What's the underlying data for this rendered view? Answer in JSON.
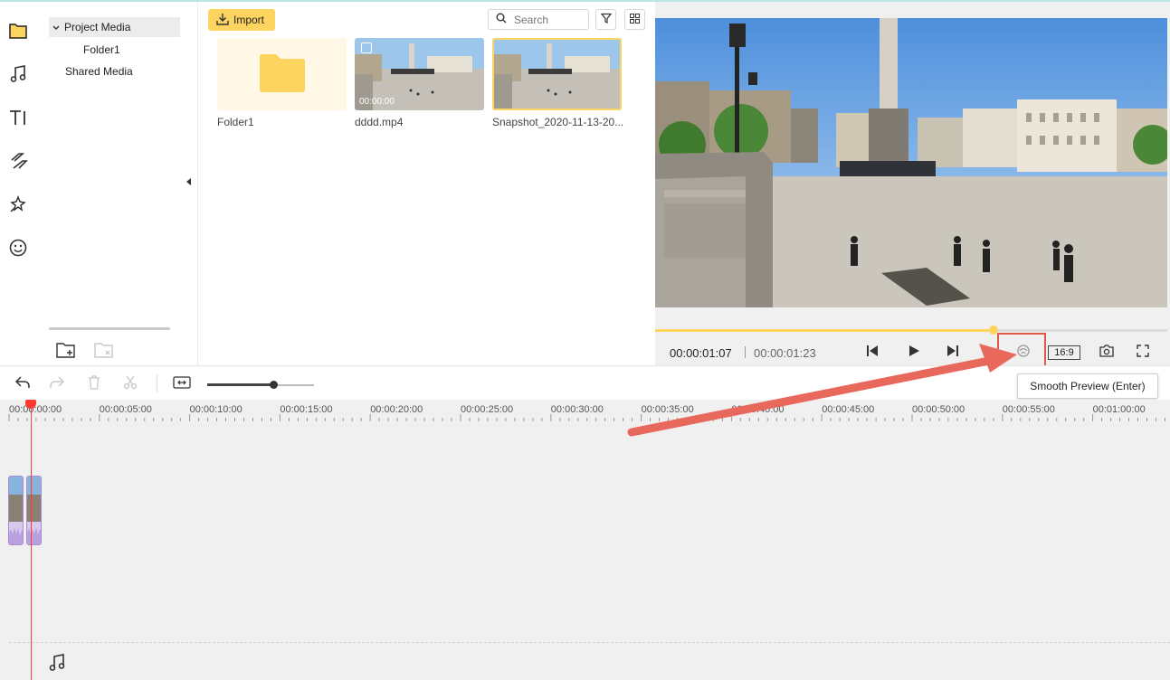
{
  "sidebar": {
    "icons": [
      "folder-icon",
      "music-icon",
      "text-icon",
      "transition-icon",
      "effects-icon",
      "sticker-icon"
    ]
  },
  "tree": {
    "project_media": "Project Media",
    "folder1": "Folder1",
    "shared_media": "Shared Media"
  },
  "media": {
    "import_label": "Import",
    "search_placeholder": "Search",
    "items": [
      {
        "name": "Folder1",
        "type": "folder"
      },
      {
        "name": "dddd.mp4",
        "type": "video",
        "duration": "00:00:00"
      },
      {
        "name": "Snapshot_2020-11-13-20...",
        "type": "image"
      }
    ]
  },
  "preview": {
    "current_time": "00:00:01:07",
    "total_time": "00:00:01:23",
    "progress": 0.66,
    "aspect_ratio": "16:9"
  },
  "timeline": {
    "tooltip": "Smooth Preview (Enter)",
    "zoom_level": 0.62,
    "ruler_labels": [
      "00:00:00:00",
      "00:00:05:00",
      "00:00:10:00",
      "00:00:15:00",
      "00:00:20:00",
      "00:00:25:00",
      "00:00:30:00",
      "00:00:35:00",
      "00:00:40:00",
      "00:00:45:00",
      "00:00:50:00",
      "00:00:55:00",
      "00:01:00:00"
    ]
  },
  "colors": {
    "accent": "#fcd45f",
    "playhead": "#ff3b30",
    "annotation": "#e05a4a",
    "clip": "#a98ad6"
  }
}
